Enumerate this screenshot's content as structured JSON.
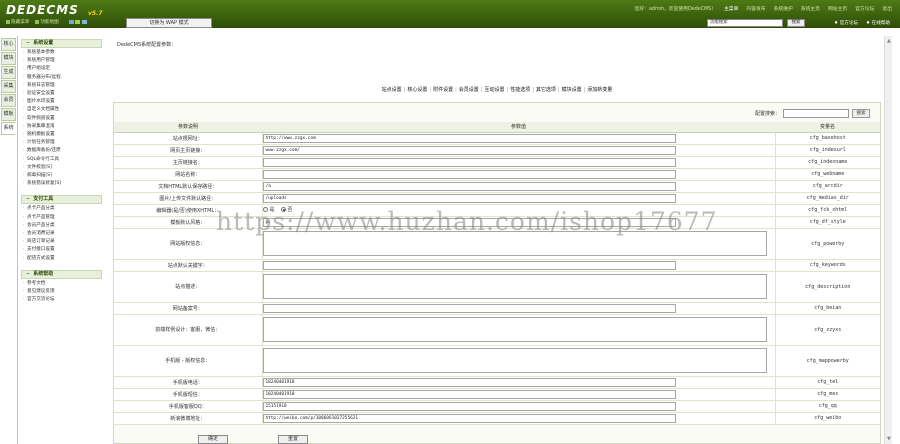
{
  "header": {
    "logo": "DEDECMS",
    "version": "v5.7",
    "nav": [
      "您好：admin，欢迎使用DedeCMS！",
      "主菜单",
      "内容发布",
      "系统维护",
      "系统主页",
      "网站主页",
      "官方论坛",
      "退出"
    ],
    "mini_buttons": [
      "隐藏菜单",
      "功能地图"
    ],
    "wap_button": "切换为 WAP 模式",
    "search_value": "功能搜索",
    "search_button": "搜索",
    "side_links": [
      "官方论坛",
      "在线帮助"
    ]
  },
  "vtabs": [
    "核心",
    "模块",
    "生成",
    "采集",
    "会员",
    "模板",
    "系统"
  ],
  "menu": [
    {
      "title": "系统设置",
      "items": [
        "系统基本参数",
        "系统用户管理",
        "用户组设定",
        "服务器分布/远程",
        "系统日志管理",
        "验证安全设置",
        "图片水印设置",
        "自定义文档属性",
        "软件频道设置",
        "防采集串混淆",
        "随机模板设置",
        "计划任务管理",
        "数据库备份/还原",
        "SQL命令行工具",
        "文件校验[S]",
        "病毒扫描[S]",
        "系统错误修复[S]"
      ]
    },
    {
      "title": "支付工具",
      "items": [
        "点卡产品分类",
        "点卡产品管理",
        "会员产品分类",
        "会员消费记录",
        "商店订单记录",
        "支付接口设置",
        "配货方式设置"
      ]
    },
    {
      "title": "系统帮助",
      "items": [
        "参考文档",
        "意见建议反馈",
        "官方交流论坛"
      ]
    }
  ],
  "main": {
    "breadcrumb": "DedeCMS系统配置参数：",
    "tabs": [
      "站点设置",
      "核心设置",
      "附件设置",
      "会员设置",
      "互动设置",
      "性能选项",
      "其它选项",
      "模块设置",
      "添加新变量"
    ],
    "search_label": "配置搜索：",
    "search_button": "搜索",
    "columns": [
      "参数说明",
      "参数值",
      "变量名"
    ],
    "rows": [
      {
        "label": "站点根网址：",
        "type": "text",
        "value": "http://www.zzgx.com",
        "var": "cfg_basehost"
      },
      {
        "label": "网页主页链接：",
        "type": "text",
        "value": "www.zzgx.com/",
        "var": "cfg_indexurl"
      },
      {
        "label": "主页链接名：",
        "type": "text",
        "value": "",
        "var": "cfg_indexname"
      },
      {
        "label": "网站名称：",
        "type": "text",
        "value": "",
        "var": "cfg_webname"
      },
      {
        "label": "文档HTML默认保存路径：",
        "type": "text",
        "value": "/a",
        "var": "cfg_arcdir"
      },
      {
        "label": "图片/上传文件默认路径：",
        "type": "text",
        "value": "/uploads",
        "var": "cfg_medias_dir"
      },
      {
        "label": "编辑器(是/否)使用XHTML：",
        "type": "radio",
        "options": [
          "是",
          "否"
        ],
        "selected": 1,
        "var": "cfg_fck_xhtml"
      },
      {
        "label": "模板默认风格：",
        "type": "text",
        "value": "pc",
        "var": "cfg_df_style"
      },
      {
        "label": "网站版权信息：",
        "type": "area",
        "value": "",
        "var": "cfg_powerby"
      },
      {
        "label": "站点默认关键字：",
        "type": "text",
        "value": "",
        "var": "cfg_keywords"
      },
      {
        "label": "站点描述：",
        "type": "area",
        "value": "",
        "var": "cfg_description"
      },
      {
        "label": "网站备案号：",
        "type": "text",
        "value": "",
        "var": "cfg_beian"
      },
      {
        "label": "前端样例设计：客服，微信：",
        "type": "area",
        "value": "",
        "var": "cfg_zzyxs"
      },
      {
        "label": "手机版 - 版权信息：",
        "type": "area",
        "value": "",
        "var": "cfg_mappowerby"
      },
      {
        "label": "手机版电话：",
        "type": "text",
        "value": "18240401918",
        "var": "cfg_tel"
      },
      {
        "label": "手机版短信：",
        "type": "text",
        "value": "18240401918",
        "var": "cfg_mes"
      },
      {
        "label": "手机版客服QQ：",
        "type": "text",
        "value": "15151918",
        "var": "cfg_qq"
      },
      {
        "label": "新浪微博地址：",
        "type": "text",
        "value": "http://weibo.com/p/1006061027255621",
        "var": "cfg_weibo"
      }
    ],
    "buttons": {
      "ok": "确定",
      "reset": "重置"
    }
  },
  "watermark": "https://www.huzhan.com/ishop17677",
  "colors": {
    "topbar": "#2d4d07",
    "accent": "#8fbf55",
    "menu_bg": "#e8f0db"
  }
}
